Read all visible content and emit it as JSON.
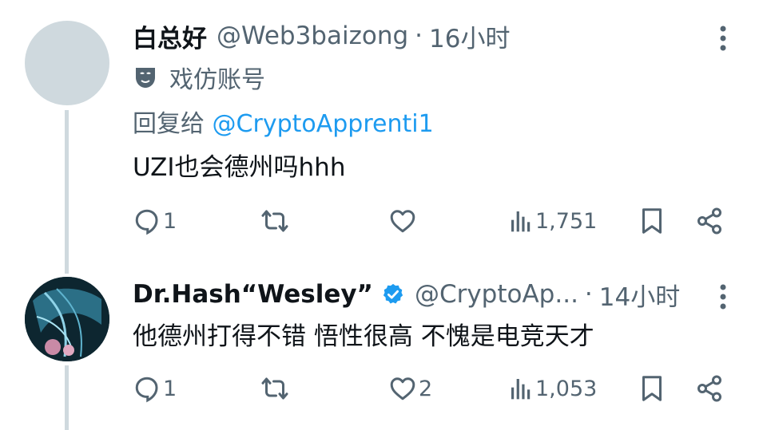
{
  "tweets": [
    {
      "name": "白总好",
      "handle": "@Web3baizong",
      "separator": "·",
      "time": "16小时",
      "parody_label": "戏仿账号",
      "reply_prefix": "回复给",
      "reply_mention": "@CryptoApprenti1",
      "text": "UZI也会德州吗hhh",
      "reply_count": "1",
      "retweet_count": "",
      "like_count": "",
      "views": "1,751",
      "icons": [
        "mask-icon",
        "more-icon",
        "reply-icon",
        "retweet-icon",
        "like-icon",
        "views-icon",
        "bookmark-icon",
        "share-icon"
      ]
    },
    {
      "name": "Dr.Hash“Wesley”",
      "handle": "@CryptoAp...",
      "separator": "·",
      "time": "14小时",
      "text": "他德州打得不错 悟性很高 不愧是电竞天才",
      "reply_count": "1",
      "retweet_count": "",
      "like_count": "2",
      "views": "1,053",
      "icons": [
        "verified-icon",
        "more-icon",
        "reply-icon",
        "retweet-icon",
        "like-icon",
        "views-icon",
        "bookmark-icon",
        "share-icon"
      ]
    }
  ],
  "colors": {
    "text": "#0f1419",
    "secondary": "#536471",
    "accent": "#1d9bf0",
    "thread_line": "#cfd9de"
  }
}
